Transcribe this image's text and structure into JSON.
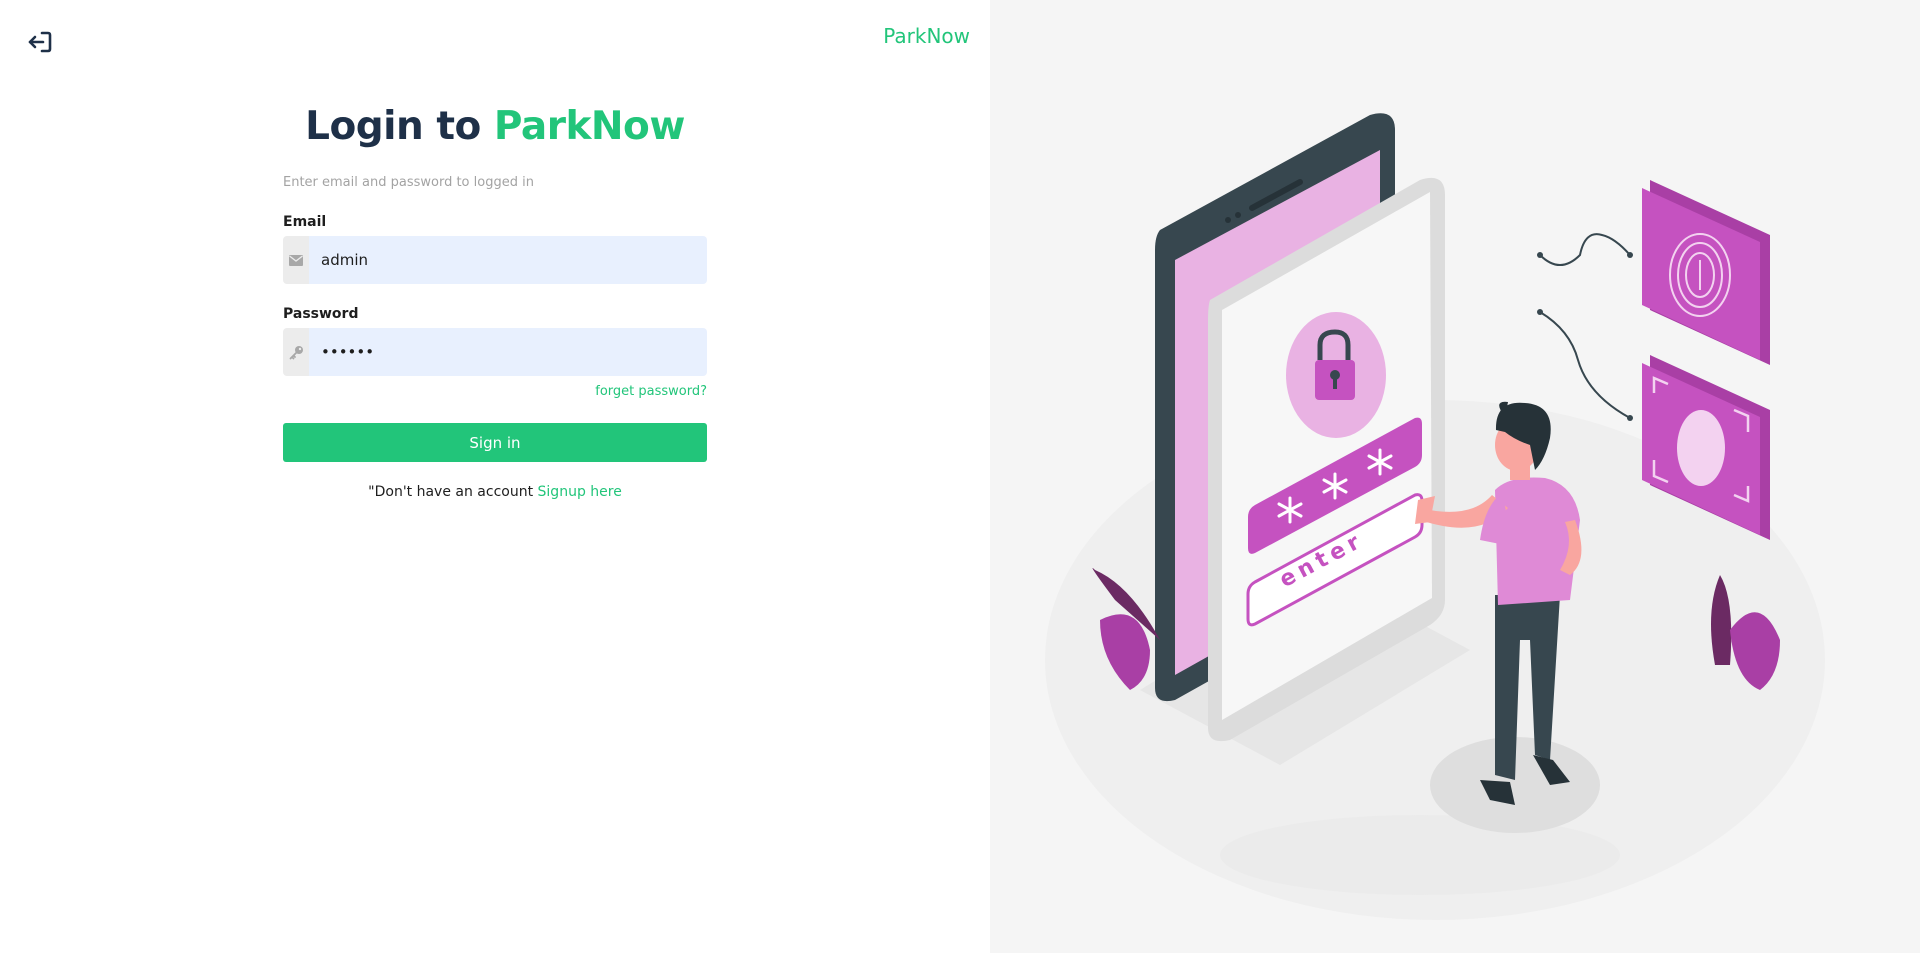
{
  "header": {
    "back_icon": "sign-in-arrow-icon",
    "brand": "ParkNow"
  },
  "login": {
    "title_prefix": "Login to ",
    "title_accent": "ParkNow",
    "subtitle": "Enter email and password to logged in",
    "email": {
      "label": "Email",
      "value": "admin",
      "icon": "envelope-icon"
    },
    "password": {
      "label": "Password",
      "value": "••••••",
      "icon": "key-icon"
    },
    "forgot_label": "forget password?",
    "signin_label": "Sign in",
    "signup_prompt": "\"Don't have an account ",
    "signup_link": "Signup here"
  },
  "illustration": {
    "enter_text": "enter",
    "accent": "#c552c0",
    "dark": "#37474f"
  },
  "colors": {
    "brand": "#22c57a",
    "title": "#1e3048",
    "input_bg": "#e8f0fe"
  }
}
